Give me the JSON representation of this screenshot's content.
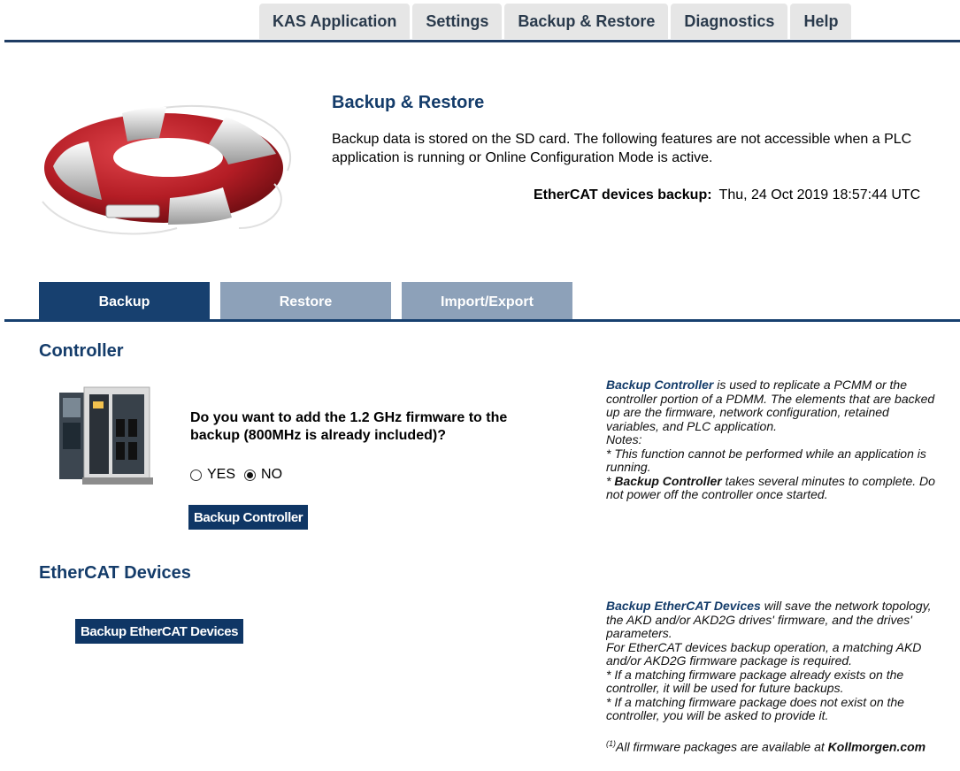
{
  "nav": {
    "tabs": [
      "KAS Application",
      "Settings",
      "Backup & Restore",
      "Diagnostics",
      "Help"
    ]
  },
  "header": {
    "title": "Backup & Restore",
    "description": "Backup data is stored on the SD card. The following features are not accessible when a PLC application is running or Online Configuration Mode is active.",
    "ethercat_backup_label": "EtherCAT devices backup:",
    "ethercat_backup_value": "Thu, 24 Oct 2019 18:57:44 UTC"
  },
  "subtabs": {
    "backup": "Backup",
    "restore": "Restore",
    "import_export": "Import/Export"
  },
  "controller": {
    "title": "Controller",
    "question": "Do you want to add the 1.2 GHz firmware to the backup (800MHz is already included)?",
    "yes_label": "YES",
    "no_label": "NO",
    "selected": "NO",
    "button": "Backup Controller",
    "help": {
      "lead": "Backup Controller",
      "text1": " is used to replicate a PCMM or the",
      "line2": "controller portion of a PDMM. The elements that are backed",
      "line3": "up are the firmware, network configuration, retained",
      "line4": "variables, and PLC application.",
      "notes": "Notes:",
      "note1a": "* This function cannot be performed while an application is",
      "note1b": "running.",
      "note2_prefix": "* ",
      "note2_bold": "Backup Controller",
      "note2_text": " takes several minutes to complete. Do",
      "note2b": "not power off the controller once started."
    }
  },
  "ethercat": {
    "title": "EtherCAT Devices",
    "button": "Backup EtherCAT Devices",
    "help": {
      "lead": "Backup EtherCAT Devices",
      "text1": " will save the network topology,",
      "line2": "the AKD and/or AKD2G drives' firmware, and the drives'",
      "line3": "parameters.",
      "line4": "For EtherCAT devices backup operation, a matching AKD",
      "line5": "and/or AKD2G firmware package is required.",
      "line6": "* If a matching firmware package already exists on the",
      "line7": "controller, it will be used for future backups.",
      "line8": "* If a matching firmware package does not exist on the",
      "line9": "controller, you will be asked to provide it.",
      "foot_sup": "(1)",
      "foot_text": "All firmware packages are available at ",
      "foot_link": "Kollmorgen.com"
    }
  },
  "colors": {
    "nav_bg": "#e6e6e6",
    "accent": "#17406f",
    "inactive_tab": "#8da1b9",
    "title_blue": "#143c6a"
  }
}
